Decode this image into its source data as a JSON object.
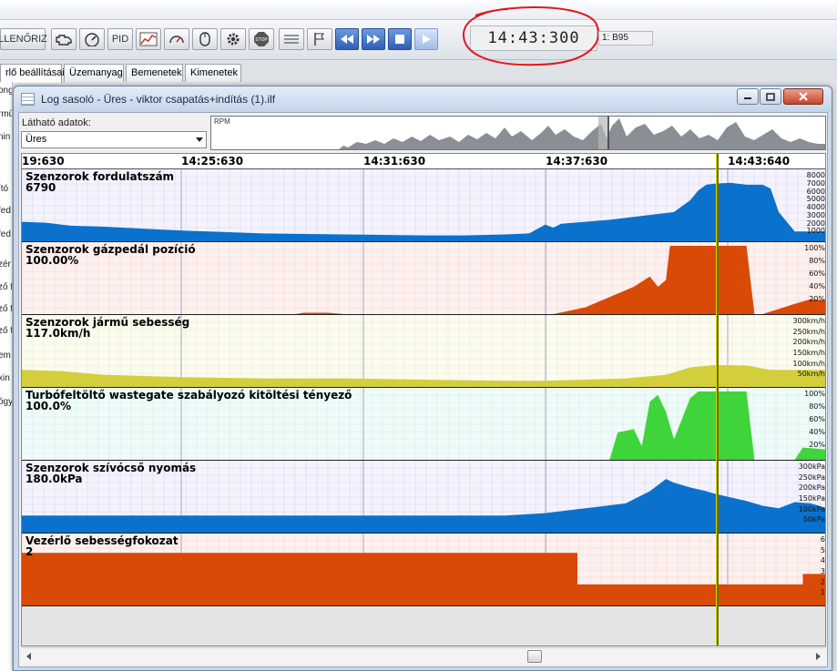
{
  "toolbar": {
    "check_label": "LLENŐRIZ",
    "pid_label": "PID",
    "clock": "14:43:300",
    "fuel_label": "1: B95"
  },
  "tabs": [
    "rlő beállításai",
    "Üzemanyag",
    "Bemenetek",
    "Kimenetek"
  ],
  "left_panel_fragments": [
    "ongő",
    "rmű",
    "nin",
    "ító",
    "fed",
    "fed",
    "zér",
    "ző ft",
    "ző ft",
    "ző ft",
    "em",
    "xin",
    "ógy"
  ],
  "log_window": {
    "title": "Log sasoló - Üres - viktor csapatás+indítás (1).ilf",
    "visible_data_label": "Látható adatok:",
    "visible_data_value": "Üres",
    "overview_label": "RPM",
    "time_ticks": [
      "19:630",
      "14:25:630",
      "14:31:630",
      "14:37:630",
      "14:43:640"
    ]
  },
  "colors": {
    "blue": "#0a72cc",
    "orange": "#d84a06",
    "yellow": "#d3cf3c",
    "green": "#3fd43a",
    "cursor": "#6b6b00",
    "annotation_red": "#e0181c"
  },
  "chart_data": [
    {
      "type": "area",
      "title": "Szenzorok fordulatszám",
      "current_value": "6790",
      "y_ticks": [
        "8000",
        "7000",
        "6000",
        "5000",
        "4000",
        "3000",
        "2000",
        "1000"
      ],
      "ylim": [
        1000,
        8000
      ],
      "color": "#0a72cc",
      "x": [
        0,
        0.03,
        0.06,
        0.1,
        0.15,
        0.2,
        0.3,
        0.4,
        0.5,
        0.55,
        0.6,
        0.63,
        0.65,
        0.66,
        0.67,
        0.7,
        0.73,
        0.76,
        0.79,
        0.81,
        0.83,
        0.84,
        0.85,
        0.86,
        0.88,
        0.9,
        0.92,
        0.93,
        0.94,
        0.96,
        0.97,
        0.98,
        1
      ],
      "values": [
        3000,
        2900,
        2600,
        2500,
        2300,
        2100,
        1800,
        1700,
        1600,
        1600,
        1700,
        1800,
        2700,
        2400,
        2800,
        3000,
        3200,
        3500,
        3800,
        4000,
        5200,
        6200,
        6800,
        6900,
        7000,
        6800,
        6800,
        6400,
        4000,
        2000,
        2000,
        2000,
        2000
      ]
    },
    {
      "type": "area",
      "title": "Szenzorok gázpedál pozíció",
      "current_value": "100.00%",
      "y_ticks": [
        "100%",
        "80%",
        "60%",
        "40%",
        "20%"
      ],
      "ylim": [
        0,
        100
      ],
      "color": "#d84a06",
      "x": [
        0,
        0.34,
        0.35,
        0.38,
        0.4,
        0.66,
        0.7,
        0.73,
        0.76,
        0.78,
        0.79,
        0.8,
        0.805,
        0.82,
        0.86,
        0.9,
        0.91,
        0.92,
        0.96,
        0.98,
        1
      ],
      "values": [
        0,
        0,
        2,
        2,
        0,
        0,
        10,
        25,
        40,
        55,
        40,
        50,
        100,
        100,
        100,
        100,
        0,
        0,
        15,
        22,
        20
      ]
    },
    {
      "type": "area",
      "title": "Szenzorok jármű sebesség",
      "current_value": "117.0km/h",
      "y_ticks": [
        "300km/h",
        "250km/h",
        "200km/h",
        "150km/h",
        "100km/h",
        "50km/h"
      ],
      "ylim": [
        30,
        310
      ],
      "color": "#d3cf3c",
      "x": [
        0,
        0.05,
        0.1,
        0.2,
        0.3,
        0.4,
        0.5,
        0.6,
        0.65,
        0.7,
        0.75,
        0.8,
        0.83,
        0.86,
        0.9,
        0.93,
        0.96,
        1
      ],
      "values": [
        100,
        95,
        80,
        70,
        65,
        65,
        60,
        55,
        55,
        60,
        65,
        80,
        110,
        120,
        118,
        100,
        100,
        100
      ]
    },
    {
      "type": "area",
      "title": "Turbófeltöltő wastegate szabályozó kitöltési tényező",
      "current_value": "100.0%",
      "y_ticks": [
        "100%",
        "80%",
        "60%",
        "40%",
        "20%"
      ],
      "ylim": [
        0,
        100
      ],
      "color": "#3fd43a",
      "x": [
        0,
        0.73,
        0.74,
        0.76,
        0.77,
        0.78,
        0.79,
        0.8,
        0.81,
        0.82,
        0.83,
        0.84,
        0.85,
        0.86,
        0.87,
        0.88,
        0.89,
        0.9,
        0.91,
        0.92,
        0.93,
        0.96,
        0.97,
        1
      ],
      "values": [
        0,
        0,
        40,
        45,
        20,
        85,
        95,
        70,
        30,
        60,
        90,
        100,
        100,
        100,
        100,
        100,
        100,
        100,
        0,
        0,
        0,
        0,
        18,
        15
      ]
    },
    {
      "type": "area",
      "title": "Szenzorok szívócső nyomás",
      "current_value": "180.0kPa",
      "y_ticks": [
        "300kPa",
        "250kPa",
        "200kPa",
        "150kPa",
        "100kPa",
        "50kPa"
      ],
      "ylim": [
        30,
        310
      ],
      "color": "#0a72cc",
      "x": [
        0,
        0.1,
        0.2,
        0.3,
        0.4,
        0.5,
        0.6,
        0.65,
        0.7,
        0.75,
        0.78,
        0.8,
        0.81,
        0.83,
        0.85,
        0.86,
        0.88,
        0.9,
        0.92,
        0.94,
        0.96,
        0.98,
        1
      ],
      "values": [
        100,
        100,
        100,
        100,
        100,
        100,
        100,
        110,
        130,
        150,
        200,
        250,
        235,
        215,
        200,
        190,
        175,
        160,
        140,
        130,
        155,
        150,
        130
      ]
    },
    {
      "type": "area",
      "title": "Vezérlő sebességfokozat",
      "current_value": "2",
      "y_ticks": [
        "6",
        "5",
        "4",
        "3",
        "2",
        "1"
      ],
      "ylim": [
        0,
        6.5
      ],
      "step": true,
      "color": "#d84a06",
      "x": [
        0,
        0.69,
        0.69,
        0.97,
        0.97,
        1
      ],
      "values": [
        5,
        5,
        2,
        2,
        3,
        3
      ]
    }
  ]
}
